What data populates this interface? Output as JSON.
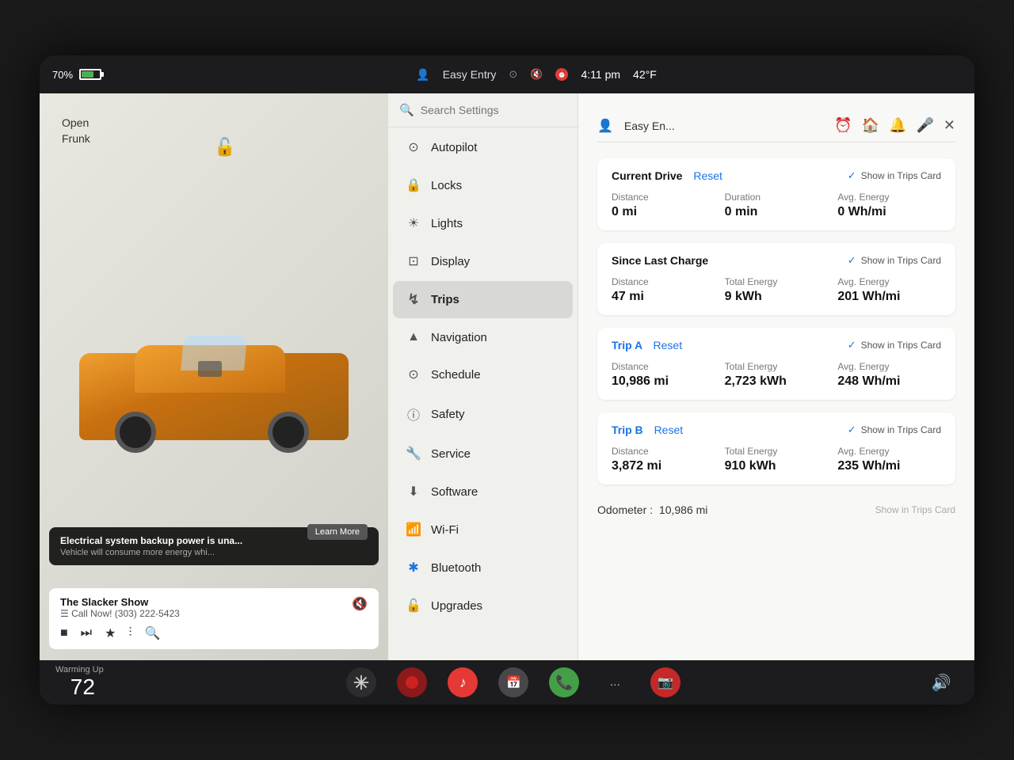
{
  "statusBar": {
    "battery_percent": "70%",
    "user_label": "Easy Entry",
    "time": "4:11 pm",
    "temperature": "42°F"
  },
  "leftPanel": {
    "open_frunk_label": "Open\nFrunk",
    "notification": {
      "title": "Electrical system backup power is una...",
      "subtitle": "Vehicle will consume more energy whi...",
      "learn_more": "Learn More"
    },
    "music": {
      "title": "The Slacker Show",
      "subtitle": "☰ Call Now! (303) 222-5423"
    }
  },
  "settingsPanel": {
    "search_placeholder": "Search Settings",
    "items": [
      {
        "id": "autopilot",
        "icon": "⊙",
        "label": "Autopilot"
      },
      {
        "id": "locks",
        "icon": "🔒",
        "label": "Locks"
      },
      {
        "id": "lights",
        "icon": "☀",
        "label": "Lights"
      },
      {
        "id": "display",
        "icon": "⊡",
        "label": "Display"
      },
      {
        "id": "trips",
        "icon": "↯",
        "label": "Trips",
        "active": true
      },
      {
        "id": "navigation",
        "icon": "▲",
        "label": "Navigation"
      },
      {
        "id": "schedule",
        "icon": "⊙",
        "label": "Schedule"
      },
      {
        "id": "safety",
        "icon": "ⓘ",
        "label": "Safety"
      },
      {
        "id": "service",
        "icon": "🔧",
        "label": "Service"
      },
      {
        "id": "software",
        "icon": "⬇",
        "label": "Software"
      },
      {
        "id": "wifi",
        "icon": "📶",
        "label": "Wi-Fi"
      },
      {
        "id": "bluetooth",
        "icon": "✱",
        "label": "Bluetooth"
      },
      {
        "id": "upgrades",
        "icon": "🔓",
        "label": "Upgrades"
      }
    ]
  },
  "tripsPanel": {
    "header": {
      "user_label": "Easy En...",
      "icons": [
        "⏰",
        "🏠",
        "🔔",
        "🎤",
        "✕"
      ]
    },
    "sections": {
      "currentDrive": {
        "title": "Current Drive",
        "reset_label": "Reset",
        "show_in_trips": "Show in Trips Card",
        "show_checked": true,
        "stats": [
          {
            "label": "Distance",
            "value": "0 mi"
          },
          {
            "label": "Duration",
            "value": "0 min"
          },
          {
            "label": "Avg. Energy",
            "value": "0 Wh/mi"
          }
        ]
      },
      "sinceLastCharge": {
        "title": "Since Last Charge",
        "show_in_trips": "Show in Trips Card",
        "show_checked": true,
        "stats": [
          {
            "label": "Distance",
            "value": "47 mi"
          },
          {
            "label": "Total Energy",
            "value": "9 kWh"
          },
          {
            "label": "Avg. Energy",
            "value": "201 Wh/mi"
          }
        ]
      },
      "tripA": {
        "title": "Trip A",
        "reset_label": "Reset",
        "show_in_trips": "Show in Trips Card",
        "show_checked": true,
        "stats": [
          {
            "label": "Distance",
            "value": "10,986 mi"
          },
          {
            "label": "Total Energy",
            "value": "2,723 kWh"
          },
          {
            "label": "Avg. Energy",
            "value": "248 Wh/mi"
          }
        ]
      },
      "tripB": {
        "title": "Trip B",
        "reset_label": "Reset",
        "show_in_trips": "Show in Trips Card",
        "show_checked": true,
        "stats": [
          {
            "label": "Distance",
            "value": "3,872 mi"
          },
          {
            "label": "Total Energy",
            "value": "910 kWh"
          },
          {
            "label": "Avg. Energy",
            "value": "235 Wh/mi"
          }
        ]
      }
    },
    "odometer": {
      "label": "Odometer :",
      "value": "10,986 mi",
      "show_in_trips": "Show in Trips Card",
      "show_checked": false
    }
  },
  "taskbar": {
    "warming_label": "Warming Up",
    "temperature": "72",
    "more_label": "...",
    "volume_label": "🔊"
  }
}
